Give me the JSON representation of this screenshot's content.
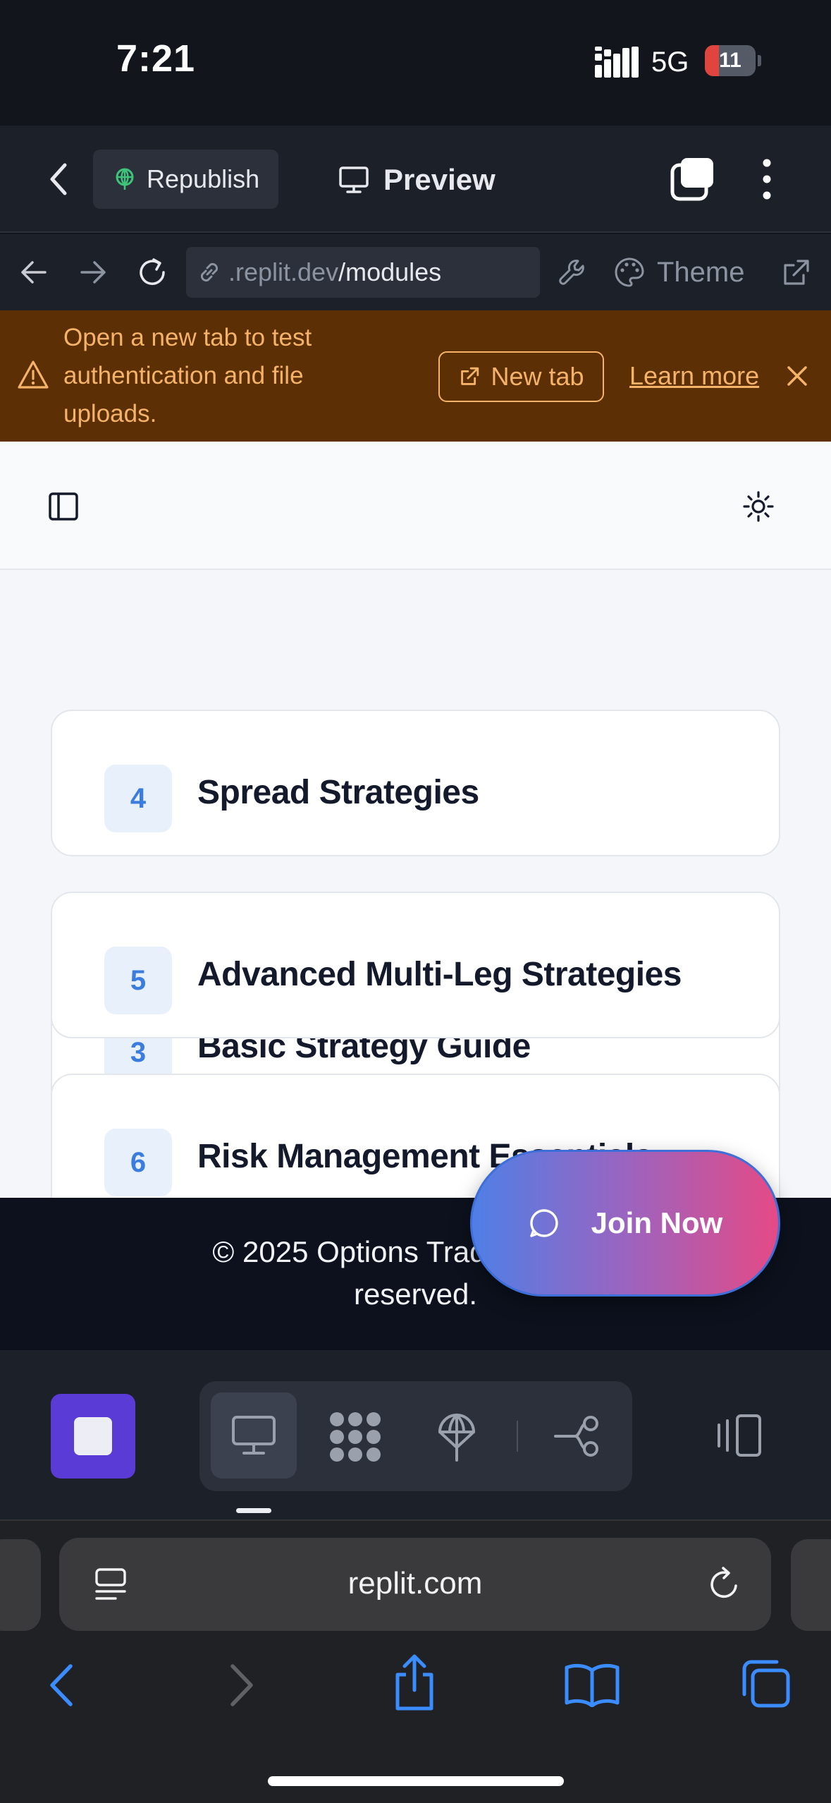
{
  "status_bar": {
    "time": "7:21",
    "network": "5G",
    "battery": "11",
    "battery_level_percent": 11
  },
  "replit_header": {
    "republish_label": "Republish",
    "preview_label": "Preview"
  },
  "url_bar": {
    "url_prefix": ".replit.dev",
    "url_path": "/modules",
    "theme_label": "Theme"
  },
  "banner": {
    "message": "Open a new tab to test authentication and file uploads.",
    "new_tab_label": "New tab",
    "learn_more_label": "Learn more"
  },
  "modules": [
    {
      "number": "3",
      "title": "Basic Strategy Guide"
    },
    {
      "number": "4",
      "title": "Spread Strategies"
    },
    {
      "number": "5",
      "title": "Advanced Multi-Leg Strategies"
    },
    {
      "number": "6",
      "title": "Risk Management Essentials"
    }
  ],
  "footer": {
    "copyright": "© 2025 Options Trading U",
    "copyright_line2": "reserved."
  },
  "join_button": {
    "label": "Join Now"
  },
  "safari": {
    "domain": "replit.com"
  },
  "colors": {
    "accent_blue": "#3b7dde",
    "stop_purple": "#5a3bd6",
    "banner_bg": "#5c2f05",
    "banner_text": "#f5b36a",
    "join_gradient_start": "#4f7fe6",
    "join_gradient_end": "#e54a86"
  }
}
